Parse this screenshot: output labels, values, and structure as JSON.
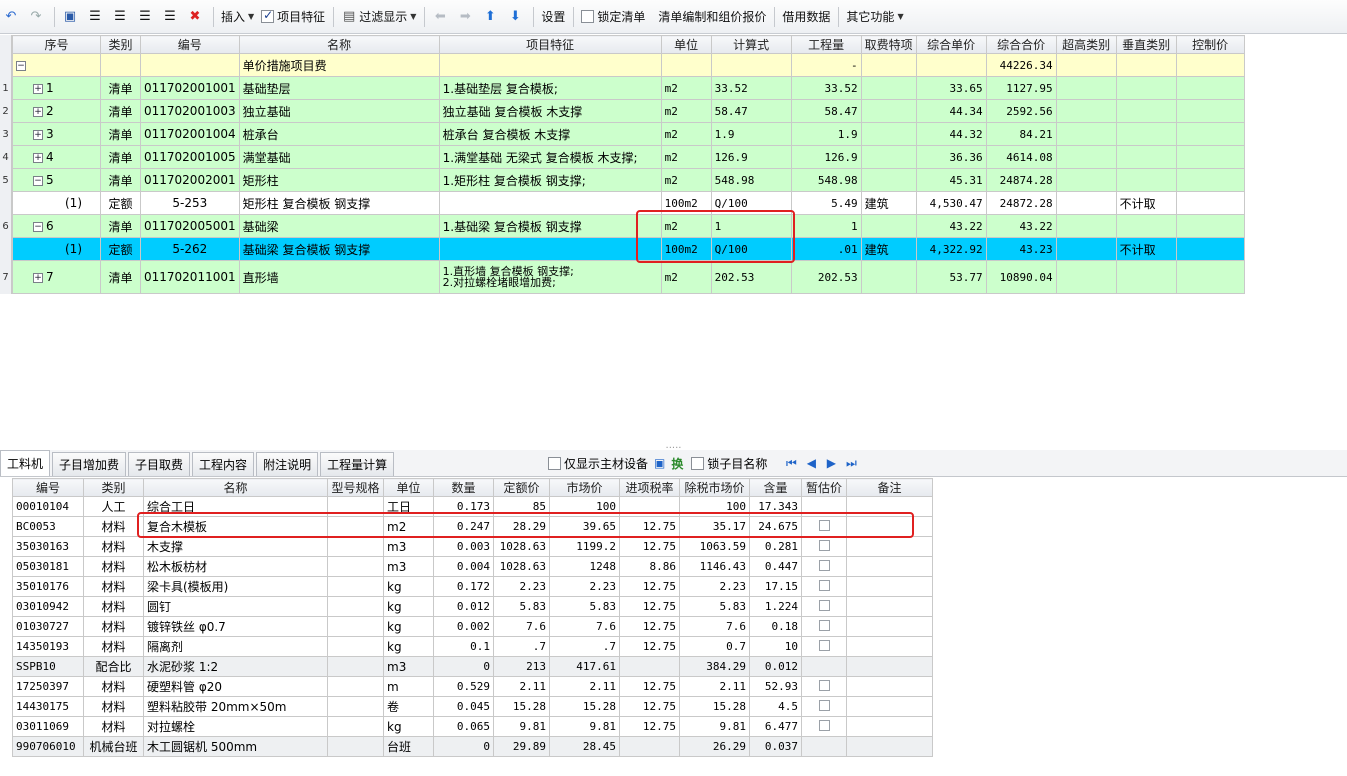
{
  "toolbar": {
    "insert": "插入",
    "item_feature": "项目特征",
    "filter_display": "过滤显示",
    "settings": "设置",
    "lock_list": "锁定清单",
    "compile_quote": "清单编制和组价报价",
    "borrow_data": "借用数据",
    "other_functions": "其它功能"
  },
  "upper_headers": [
    "序号",
    "类别",
    "编号",
    "名称",
    "项目特征",
    "单位",
    "计算式",
    "工程量",
    "取费特项",
    "综合单价",
    "综合合价",
    "超高类别",
    "垂直类别",
    "控制价"
  ],
  "upper_rows": [
    {
      "rn": "",
      "seq": "",
      "type": "",
      "code": "",
      "name": "单价措施项目费",
      "feature": "",
      "unit": "",
      "formula": "",
      "qty": "-",
      "fee": "",
      "uprice": "",
      "total": "44226.34",
      "super": "",
      "vert": ""
    },
    {
      "rn": "1",
      "seq": "1",
      "type": "清单",
      "code": "011702001001",
      "name": "基础垫层",
      "feature": "1.基础垫层 复合模板;",
      "unit": "m2",
      "formula": "33.52",
      "qty": "33.52",
      "fee": "",
      "uprice": "33.65",
      "total": "1127.95",
      "super": "",
      "vert": ""
    },
    {
      "rn": "2",
      "seq": "2",
      "type": "清单",
      "code": "011702001003",
      "name": "独立基础",
      "feature": "独立基础 复合模板 木支撑",
      "unit": "m2",
      "formula": "58.47",
      "qty": "58.47",
      "fee": "",
      "uprice": "44.34",
      "total": "2592.56",
      "super": "",
      "vert": ""
    },
    {
      "rn": "3",
      "seq": "3",
      "type": "清单",
      "code": "011702001004",
      "name": "桩承台",
      "feature": "桩承台 复合模板 木支撑",
      "unit": "m2",
      "formula": "1.9",
      "qty": "1.9",
      "fee": "",
      "uprice": "44.32",
      "total": "84.21",
      "super": "",
      "vert": ""
    },
    {
      "rn": "4",
      "seq": "4",
      "type": "清单",
      "code": "011702001005",
      "name": "满堂基础",
      "feature": "1.满堂基础 无梁式 复合模板 木支撑;",
      "unit": "m2",
      "formula": "126.9",
      "qty": "126.9",
      "fee": "",
      "uprice": "36.36",
      "total": "4614.08",
      "super": "",
      "vert": ""
    },
    {
      "rn": "5",
      "seq": "5",
      "type": "清单",
      "code": "011702002001",
      "name": "矩形柱",
      "feature": "1.矩形柱 复合模板 钢支撑;",
      "unit": "m2",
      "formula": "548.98",
      "qty": "548.98",
      "fee": "",
      "uprice": "45.31",
      "total": "24874.28",
      "super": "",
      "vert": ""
    },
    {
      "rn": "",
      "seq": "(1)",
      "type": "定额",
      "code": "5-253",
      "name": "矩形柱 复合模板 钢支撑",
      "feature": "",
      "unit": "100m2",
      "formula": "Q/100",
      "qty": "5.49",
      "fee": "建筑",
      "uprice": "4,530.47",
      "total": "24872.28",
      "super": "",
      "vert": "不计取"
    },
    {
      "rn": "6",
      "seq": "6",
      "type": "清单",
      "code": "011702005001",
      "name": "基础梁",
      "feature": "1.基础梁 复合模板 钢支撑",
      "unit": "m2",
      "formula": "1",
      "qty": "1",
      "fee": "",
      "uprice": "43.22",
      "total": "43.22",
      "super": "",
      "vert": ""
    },
    {
      "rn": "",
      "seq": "(1)",
      "type": "定额",
      "code": "5-262",
      "name": "基础梁 复合模板 钢支撑",
      "feature": "",
      "unit": "100m2",
      "formula": "Q/100",
      "qty": ".01",
      "fee": "建筑",
      "uprice": "4,322.92",
      "total": "43.23",
      "super": "",
      "vert": "不计取"
    },
    {
      "rn": "7",
      "seq": "7",
      "type": "清单",
      "code": "011702011001",
      "name": "直形墙",
      "feature": "1.直形墙 复合模板 钢支撑;",
      "feature2": "2.对拉螺栓堵眼增加费;",
      "unit": "m2",
      "formula": "202.53",
      "qty": "202.53",
      "fee": "",
      "uprice": "53.77",
      "total": "10890.04",
      "super": "",
      "vert": ""
    }
  ],
  "tabs": [
    "工料机",
    "子目增加费",
    "子目取费",
    "工程内容",
    "附注说明",
    "工程量计算"
  ],
  "lower_tools": {
    "main_only": "仅显示主材设备",
    "swap": "换",
    "lock_name": "锁子目名称"
  },
  "lower_headers": [
    "编号",
    "类别",
    "名称",
    "型号规格",
    "单位",
    "数量",
    "定额价",
    "市场价",
    "进项税率",
    "除税市场价",
    "含量",
    "暂估价",
    "备注"
  ],
  "lower_rows": [
    {
      "code": "00010104",
      "type": "人工",
      "name": "综合工日",
      "spec": "",
      "unit": "工日",
      "qty": "0.173",
      "quota": "85",
      "market": "100",
      "tax": "",
      "nettax": "100",
      "content": "17.343",
      "est": false
    },
    {
      "code": "BC0053",
      "type": "材料",
      "name": "复合木模板",
      "spec": "",
      "unit": "m2",
      "qty": "0.247",
      "quota": "28.29",
      "market": "39.65",
      "tax": "12.75",
      "nettax": "35.17",
      "content": "24.675",
      "est": true
    },
    {
      "code": "35030163",
      "type": "材料",
      "name": "木支撑",
      "spec": "",
      "unit": "m3",
      "qty": "0.003",
      "quota": "1028.63",
      "market": "1199.2",
      "tax": "12.75",
      "nettax": "1063.59",
      "content": "0.281",
      "est": true
    },
    {
      "code": "05030181",
      "type": "材料",
      "name": "松木板枋材",
      "spec": "",
      "unit": "m3",
      "qty": "0.004",
      "quota": "1028.63",
      "market": "1248",
      "tax": "8.86",
      "nettax": "1146.43",
      "content": "0.447",
      "est": true
    },
    {
      "code": "35010176",
      "type": "材料",
      "name": "梁卡具(模板用)",
      "spec": "",
      "unit": "kg",
      "qty": "0.172",
      "quota": "2.23",
      "market": "2.23",
      "tax": "12.75",
      "nettax": "2.23",
      "content": "17.15",
      "est": true
    },
    {
      "code": "03010942",
      "type": "材料",
      "name": "圆钉",
      "spec": "",
      "unit": "kg",
      "qty": "0.012",
      "quota": "5.83",
      "market": "5.83",
      "tax": "12.75",
      "nettax": "5.83",
      "content": "1.224",
      "est": true
    },
    {
      "code": "01030727",
      "type": "材料",
      "name": "镀锌铁丝 φ0.7",
      "spec": "",
      "unit": "kg",
      "qty": "0.002",
      "quota": "7.6",
      "market": "7.6",
      "tax": "12.75",
      "nettax": "7.6",
      "content": "0.18",
      "est": true
    },
    {
      "code": "14350193",
      "type": "材料",
      "name": "隔离剂",
      "spec": "",
      "unit": "kg",
      "qty": "0.1",
      "quota": ".7",
      "market": ".7",
      "tax": "12.75",
      "nettax": "0.7",
      "content": "10",
      "est": true
    },
    {
      "code": "SSPB10",
      "type": "配合比",
      "name": "水泥砂浆 1:2",
      "spec": "",
      "unit": "m3",
      "qty": "0",
      "quota": "213",
      "market": "417.61",
      "tax": "",
      "nettax": "384.29",
      "content": "0.012",
      "est": false
    },
    {
      "code": "17250397",
      "type": "材料",
      "name": "硬塑料管 φ20",
      "spec": "",
      "unit": "m",
      "qty": "0.529",
      "quota": "2.11",
      "market": "2.11",
      "tax": "12.75",
      "nettax": "2.11",
      "content": "52.93",
      "est": true
    },
    {
      "code": "14430175",
      "type": "材料",
      "name": "塑料粘胶带 20mm×50m",
      "spec": "",
      "unit": "卷",
      "qty": "0.045",
      "quota": "15.28",
      "market": "15.28",
      "tax": "12.75",
      "nettax": "15.28",
      "content": "4.5",
      "est": true
    },
    {
      "code": "03011069",
      "type": "材料",
      "name": "对拉螺栓",
      "spec": "",
      "unit": "kg",
      "qty": "0.065",
      "quota": "9.81",
      "market": "9.81",
      "tax": "12.75",
      "nettax": "9.81",
      "content": "6.477",
      "est": true
    },
    {
      "code": "990706010",
      "type": "机械台班",
      "name": "木工圆锯机 500mm",
      "spec": "",
      "unit": "台班",
      "qty": "0",
      "quota": "29.89",
      "market": "28.45",
      "tax": "",
      "nettax": "26.29",
      "content": "0.037",
      "est": false
    }
  ],
  "bold_market": [
    "100",
    "39.65",
    "1199.2",
    "1248",
    "417.61",
    "28.45"
  ]
}
